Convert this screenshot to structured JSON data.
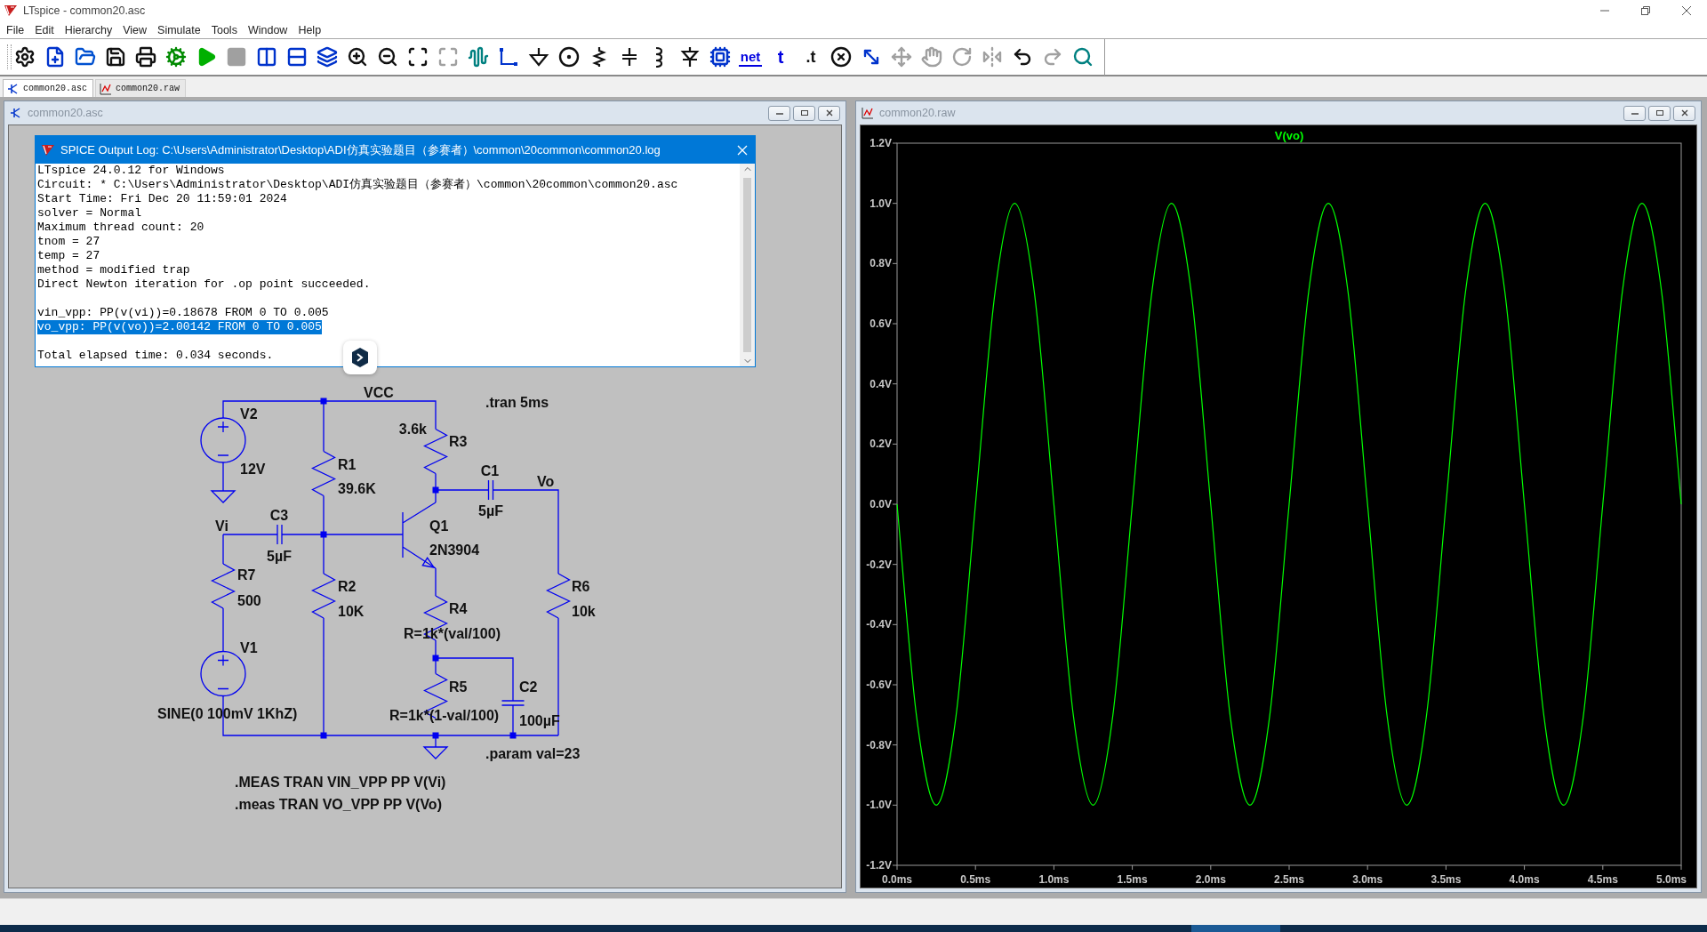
{
  "window": {
    "title": "LTspice - common20.asc"
  },
  "menu": [
    "File",
    "Edit",
    "Hierarchy",
    "View",
    "Simulate",
    "Tools",
    "Window",
    "Help"
  ],
  "toolbar_text_buttons": [
    "net",
    "t",
    ".t"
  ],
  "document_tabs": [
    {
      "label": "common20.asc",
      "kind": "schematic",
      "selected": true
    },
    {
      "label": "common20.raw",
      "kind": "waveform",
      "selected": false
    }
  ],
  "schematic_window": {
    "title": "common20.asc"
  },
  "schematic": {
    "net_labels": [
      "VCC",
      "Vo",
      "Vi"
    ],
    "components": [
      {
        "ref": "V2",
        "value": "12V",
        "kind": "voltage_source"
      },
      {
        "ref": "R1",
        "value": "39.6K",
        "kind": "resistor"
      },
      {
        "ref": "R3",
        "value": "3.6k",
        "kind": "resistor"
      },
      {
        "ref": "C1",
        "value": "5µF",
        "kind": "capacitor"
      },
      {
        "ref": "C3",
        "value": "5µF",
        "kind": "capacitor"
      },
      {
        "ref": "Q1",
        "value": "2N3904",
        "kind": "npn"
      },
      {
        "ref": "R7",
        "value": "500",
        "kind": "resistor"
      },
      {
        "ref": "R2",
        "value": "10K",
        "kind": "resistor"
      },
      {
        "ref": "R6",
        "value": "10k",
        "kind": "resistor"
      },
      {
        "ref": "R4",
        "value": "R=1k*(val/100)",
        "kind": "resistor"
      },
      {
        "ref": "V1",
        "value": "SINE(0 100mV 1KhZ)",
        "kind": "voltage_source"
      },
      {
        "ref": "R5",
        "value": "R=1k*(1-val/100)",
        "kind": "resistor"
      },
      {
        "ref": "C2",
        "value": "100µF",
        "kind": "capacitor"
      }
    ],
    "directives": [
      ".tran 5ms",
      ".param val=23",
      ".MEAS TRAN VIN_VPP PP V(Vi)",
      ".meas TRAN VO_VPP PP V(Vo)"
    ]
  },
  "log_window": {
    "title": "SPICE Output Log: C:\\Users\\Administrator\\Desktop\\ADI仿真实验题目（参赛者）\\common\\20common\\common20.log",
    "blocks": [
      [
        {
          "text": "LTspice 24.0.12 for Windows",
          "selected": false
        },
        {
          "text": "Circuit: * C:\\Users\\Administrator\\Desktop\\ADI仿真实验题目（参赛者）\\common\\20common\\common20.asc",
          "selected": false
        },
        {
          "text": "Start Time: Fri Dec 20 11:59:01 2024",
          "selected": false
        },
        {
          "text": "solver = Normal",
          "selected": false
        },
        {
          "text": "Maximum thread count: 20",
          "selected": false
        },
        {
          "text": "tnom = 27",
          "selected": false
        },
        {
          "text": "temp = 27",
          "selected": false
        },
        {
          "text": "method = modified trap",
          "selected": false
        },
        {
          "text": "Direct Newton iteration for .op point succeeded.",
          "selected": false
        }
      ],
      [
        {
          "text": "vin_vpp: PP(v(vi))=0.18678 FROM 0 TO 0.005",
          "selected": false
        },
        {
          "text": "vo_vpp: PP(v(vo))=2.00142 FROM 0 TO 0.005",
          "selected": true
        }
      ],
      [
        {
          "text": "Total elapsed time: 0.034 seconds.",
          "selected": false
        }
      ]
    ]
  },
  "waveform_window": {
    "title": "common20.raw",
    "chart_data": {
      "type": "line",
      "xlim": [
        0,
        5
      ],
      "ylim": [
        -1.2,
        1.2
      ],
      "xticks": [
        {
          "value": 0,
          "label": "0.0ms"
        },
        {
          "value": 0.5,
          "label": "0.5ms"
        },
        {
          "value": 1,
          "label": "1.0ms"
        },
        {
          "value": 1.5,
          "label": "1.5ms"
        },
        {
          "value": 2,
          "label": "2.0ms"
        },
        {
          "value": 2.5,
          "label": "2.5ms"
        },
        {
          "value": 3,
          "label": "3.0ms"
        },
        {
          "value": 3.5,
          "label": "3.5ms"
        },
        {
          "value": 4,
          "label": "4.0ms"
        },
        {
          "value": 4.5,
          "label": "4.5ms"
        },
        {
          "value": 5,
          "label": "5.0ms"
        }
      ],
      "yticks": [
        {
          "value": 1.2,
          "label": "1.2V"
        },
        {
          "value": 1,
          "label": "1.0V"
        },
        {
          "value": 0.8,
          "label": "0.8V"
        },
        {
          "value": 0.6,
          "label": "0.6V"
        },
        {
          "value": 0.4,
          "label": "0.4V"
        },
        {
          "value": 0.2,
          "label": "0.2V"
        },
        {
          "value": 0,
          "label": "0.0V"
        },
        {
          "value": -0.2,
          "label": "-0.2V"
        },
        {
          "value": -0.4,
          "label": "-0.4V"
        },
        {
          "value": -0.6,
          "label": "-0.6V"
        },
        {
          "value": -0.8,
          "label": "-0.8V"
        },
        {
          "value": -1,
          "label": "-1.0V"
        },
        {
          "value": -1.2,
          "label": "-1.2V"
        }
      ],
      "x": [
        0,
        0.125,
        0.25,
        0.375,
        0.5,
        0.625,
        0.75,
        0.875,
        1,
        1.125,
        1.25,
        1.375,
        1.5,
        1.625,
        1.75,
        1.875,
        2,
        2.125,
        2.25,
        2.375,
        2.5,
        2.625,
        2.75,
        2.875,
        3,
        3.125,
        3.25,
        3.375,
        3.5,
        3.625,
        3.75,
        3.875,
        4,
        4.125,
        4.25,
        4.375,
        4.5,
        4.625,
        4.75,
        4.875,
        5
      ],
      "series": [
        {
          "name": "V(vo)",
          "color": "#00ff00",
          "values": [
            0,
            -0.707,
            -1,
            -0.707,
            0,
            0.707,
            1,
            0.707,
            0,
            -0.707,
            -1,
            -0.707,
            0,
            0.707,
            1,
            0.707,
            0,
            -0.707,
            -1,
            -0.707,
            0,
            0.707,
            1,
            0.707,
            0,
            -0.707,
            -1,
            -0.707,
            0,
            0.707,
            1,
            0.707,
            0,
            -0.707,
            -1,
            -0.707,
            0,
            0.707,
            1,
            0.707,
            0
          ]
        }
      ]
    }
  }
}
